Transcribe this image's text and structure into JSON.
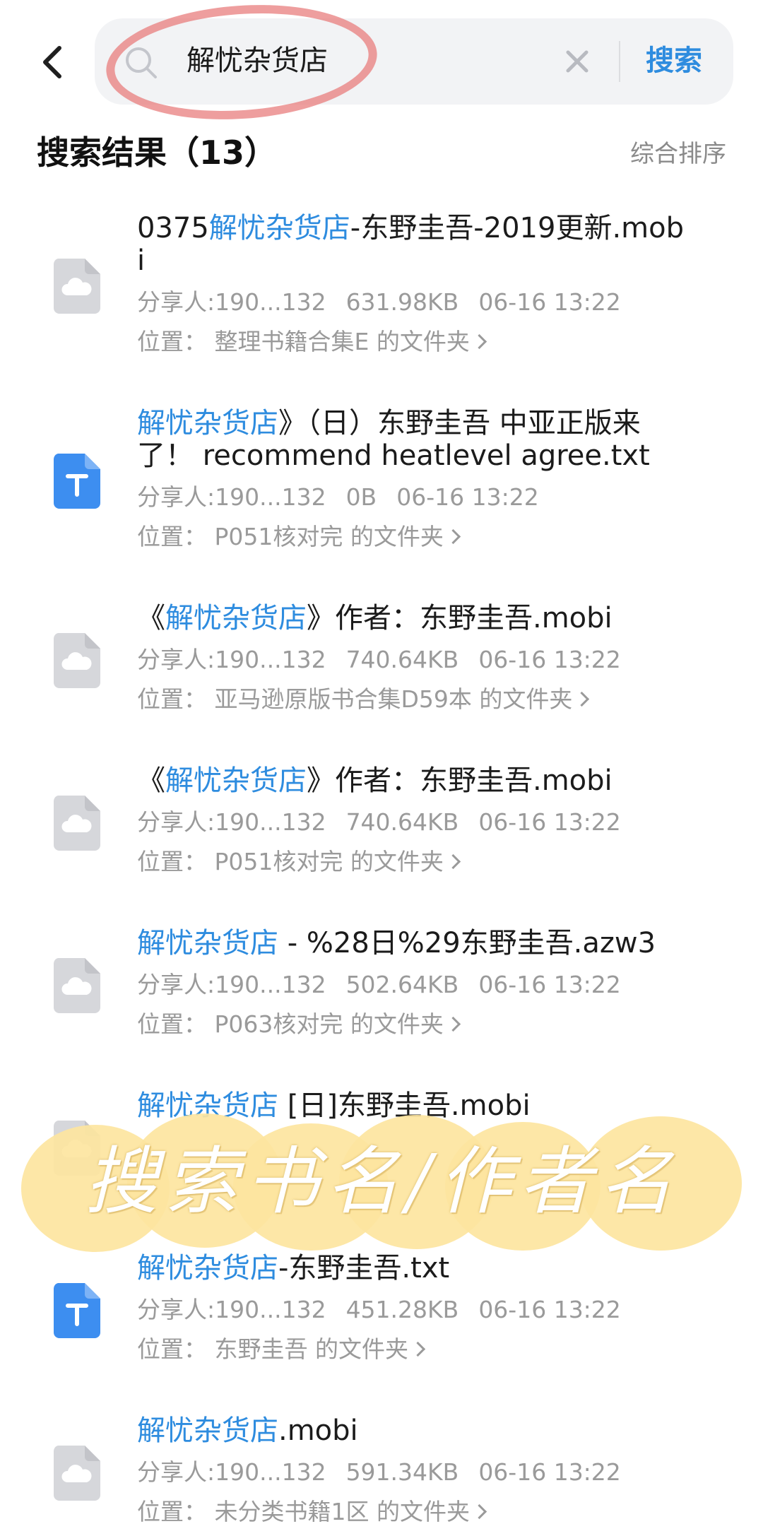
{
  "search": {
    "query": "解忧杂货店",
    "button_label": "搜索"
  },
  "results_header": {
    "title": "搜索结果（13）",
    "sort_label": "综合排序"
  },
  "results": [
    {
      "icon": "cloud-file-icon",
      "title_prefix": "0375",
      "title_highlight": "解忧杂货店",
      "title_suffix": "-东野圭吾-2019更新.mobi",
      "sharer": "分享人:190...132",
      "size": "631.98KB",
      "time": "06-16 13:22",
      "location": "位置：  整理书籍合集E 的文件夹"
    },
    {
      "icon": "text-file-icon",
      "title_prefix": "",
      "title_highlight": "解忧杂货店",
      "title_suffix": "》（日）东野圭吾 中亚正版来了！  recommend  heatlevel  agree.txt",
      "sharer": "分享人:190...132",
      "size": "0B",
      "time": "06-16 13:22",
      "location": "位置：  P051核对完 的文件夹"
    },
    {
      "icon": "cloud-file-icon",
      "title_prefix": "《",
      "title_highlight": "解忧杂货店",
      "title_suffix": "》作者：东野圭吾.mobi",
      "sharer": "分享人:190...132",
      "size": "740.64KB",
      "time": "06-16 13:22",
      "location": "位置：  亚马逊原版书合集D59本 的文件夹"
    },
    {
      "icon": "cloud-file-icon",
      "title_prefix": "《",
      "title_highlight": "解忧杂货店",
      "title_suffix": "》作者：东野圭吾.mobi",
      "sharer": "分享人:190...132",
      "size": "740.64KB",
      "time": "06-16 13:22",
      "location": "位置：  P051核对完 的文件夹"
    },
    {
      "icon": "cloud-file-icon",
      "title_prefix": "",
      "title_highlight": "解忧杂货店",
      "title_suffix": " - %28日%29东野圭吾.azw3",
      "sharer": "分享人:190...132",
      "size": "502.64KB",
      "time": "06-16 13:22",
      "location": "位置：  P063核对完 的文件夹"
    },
    {
      "icon": "cloud-file-icon",
      "title_prefix": "",
      "title_highlight": "解忧杂货店",
      "title_suffix": " [日]东野圭吾.mobi",
      "sharer": "",
      "size": "",
      "time": "",
      "location": ""
    },
    {
      "icon": "text-file-icon",
      "title_prefix": "",
      "title_highlight": "解忧杂货店",
      "title_suffix": "-东野圭吾.txt",
      "sharer": "分享人:190...132",
      "size": "451.28KB",
      "time": "06-16 13:22",
      "location": "位置：  东野圭吾 的文件夹"
    },
    {
      "icon": "cloud-file-icon",
      "title_prefix": "",
      "title_highlight": "解忧杂货店",
      "title_suffix": ".mobi",
      "sharer": "分享人:190...132",
      "size": "591.34KB",
      "time": "06-16 13:22",
      "location": "位置：  未分类书籍1区 的文件夹"
    }
  ],
  "sticker": {
    "text": "搜索书名/作者名"
  },
  "colors": {
    "accent": "#2e8cdf",
    "meta_text": "#9a9a9a",
    "text_file_icon": "#3d8ef0",
    "cloud_file_icon": "#d6d7db",
    "annotation": "#e87878",
    "sticker": "#fde59f"
  }
}
